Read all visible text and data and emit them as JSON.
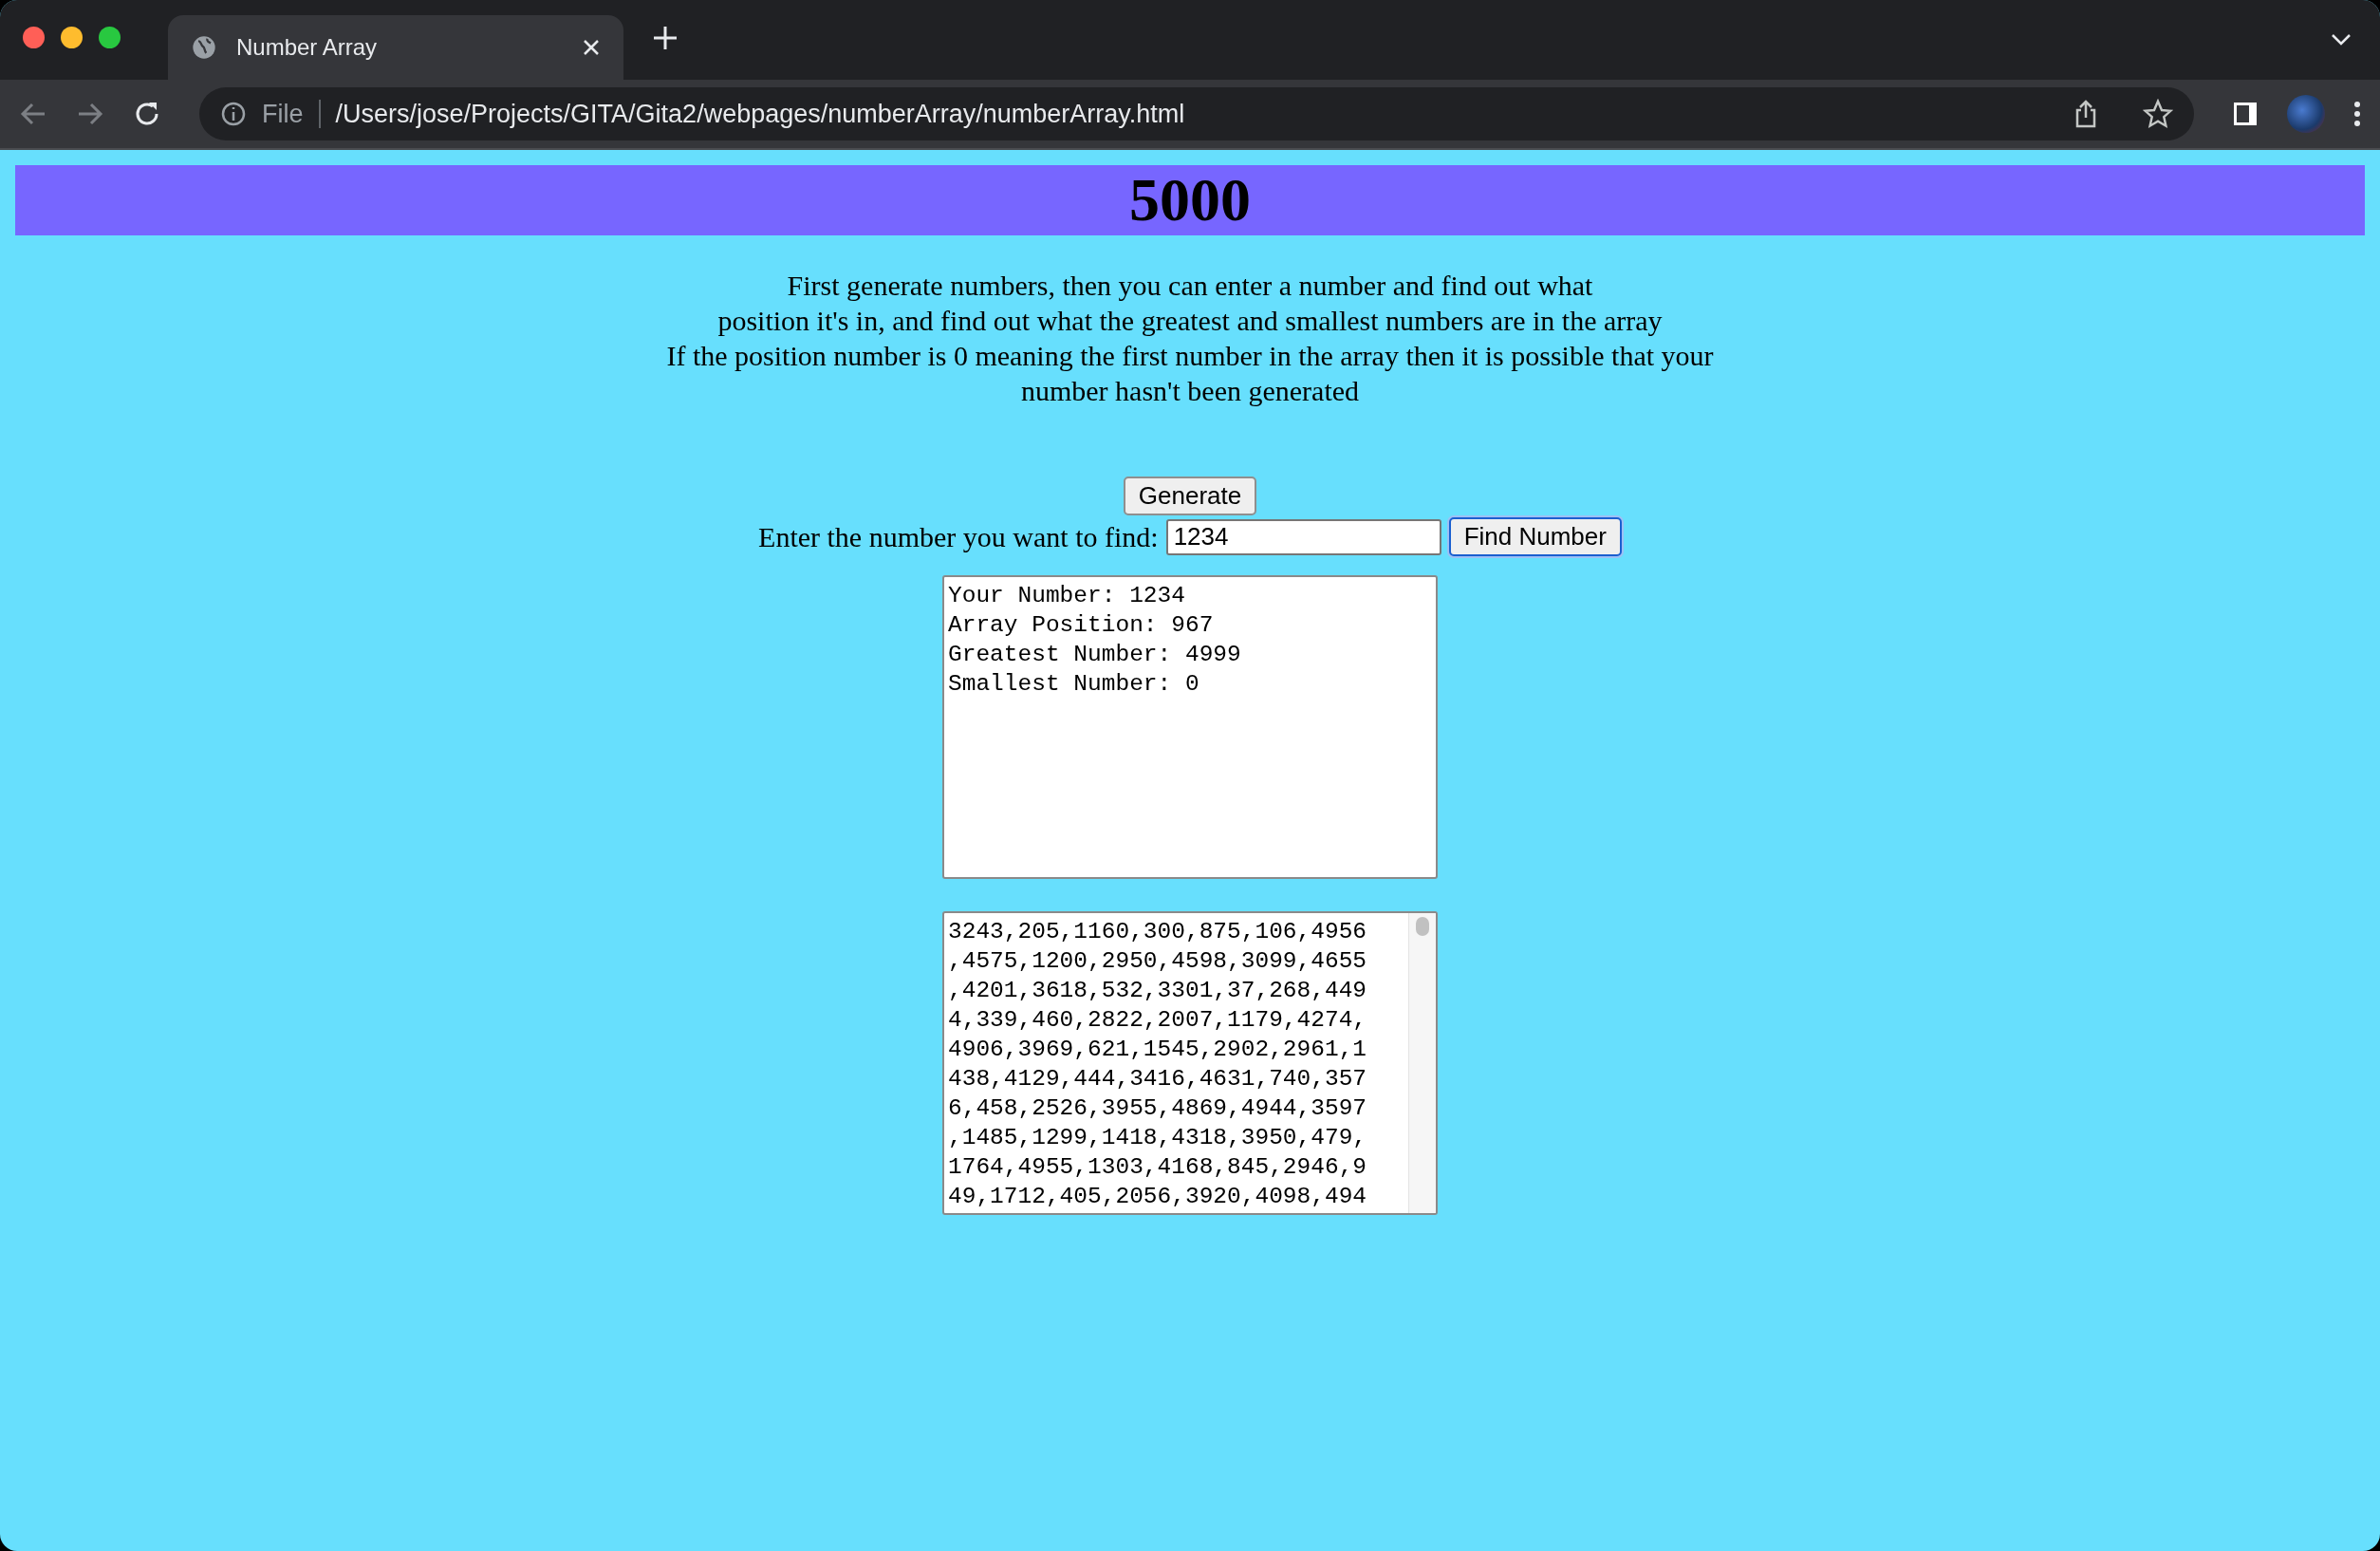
{
  "browser": {
    "tab": {
      "title": "Number Array",
      "selected": true
    },
    "address": {
      "scheme": "File",
      "url": "/Users/jose/Projects/GITA/Gita2/webpages/numberArray/numberArray.html"
    }
  },
  "header": {
    "title": "5000"
  },
  "instructions": [
    "First generate numbers, then you can enter a number and find out what",
    "position it's in, and find out what the greatest and smallest numbers are in the array",
    "If the position number is 0 meaning the first number in the array then it is possible that your",
    "number hasn't been generated"
  ],
  "generate_button": "Generate",
  "find": {
    "label": "Enter the number you want to find:",
    "value": "1234",
    "button": "Find Number"
  },
  "result_lines": [
    "Your Number: 1234",
    "Array Position: 967",
    "Greatest Number: 4999",
    "Smallest Number: 0"
  ],
  "array_lines": [
    "3243,205,1160,300,875,106,4956",
    ",4575,1200,2950,4598,3099,4655",
    ",4201,3618,532,3301,37,268,449",
    "4,339,460,2822,2007,1179,4274,",
    "4906,3969,621,1545,2902,2961,1",
    "438,4129,444,3416,4631,740,357",
    "6,458,2526,3955,4869,4944,3597",
    ",1485,1299,1418,4318,3950,479,",
    "1764,4955,1303,4168,845,2946,9",
    "49,1712,405,2056,3920,4098,494"
  ]
}
